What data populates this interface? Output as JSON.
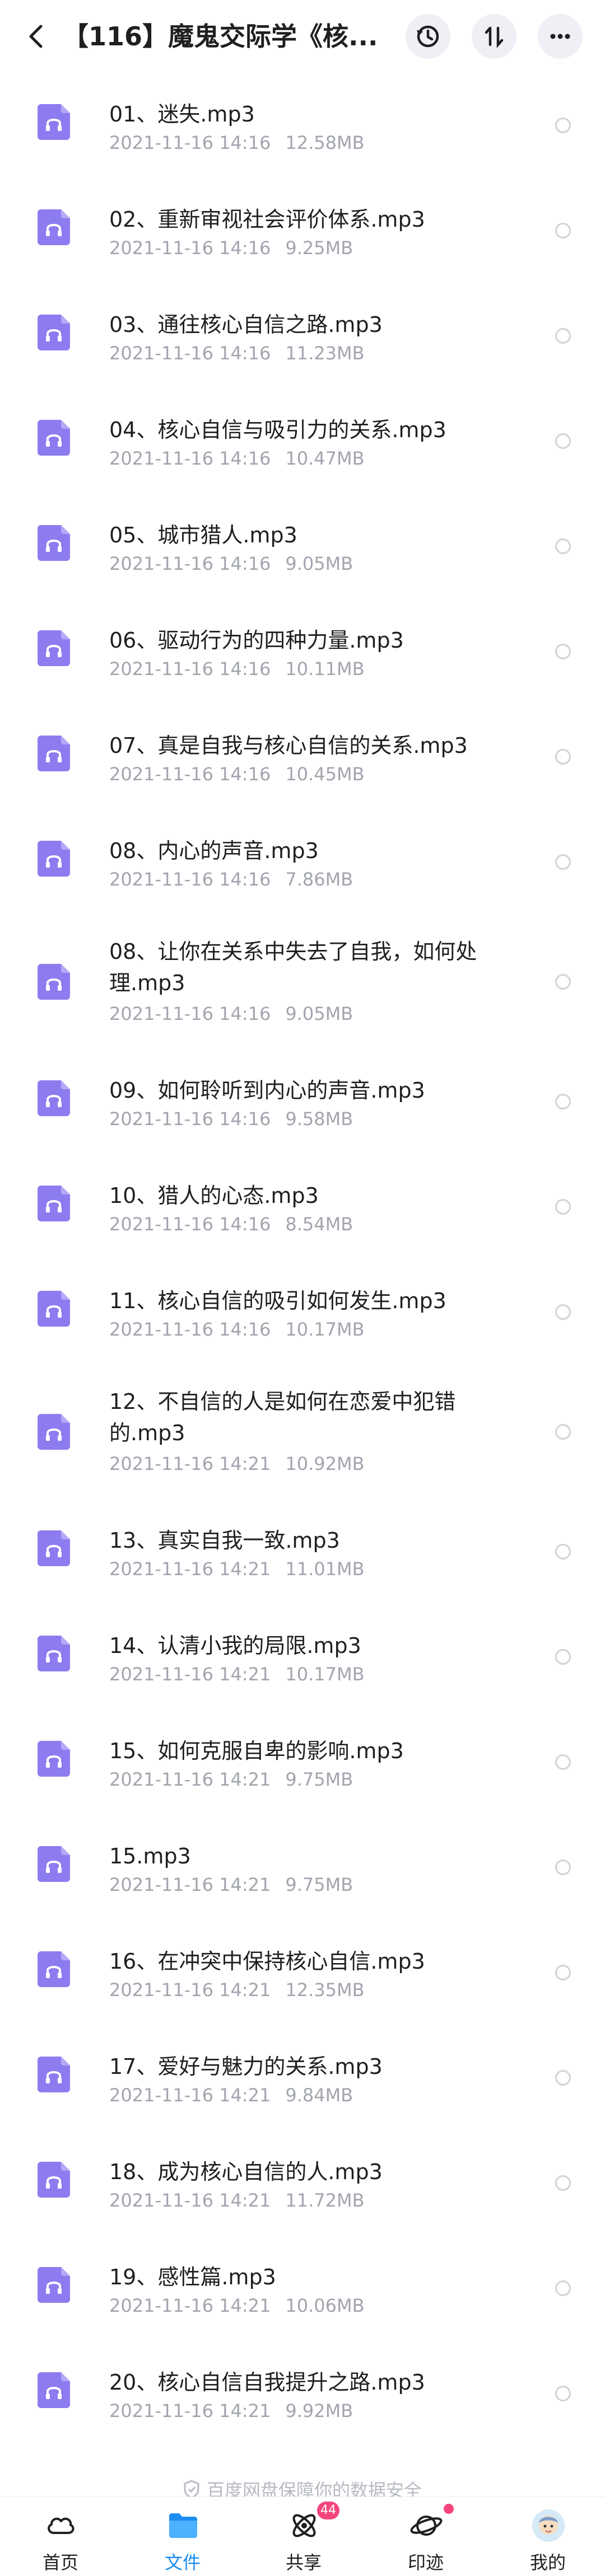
{
  "header": {
    "title": "【116】魔鬼交际学《核...",
    "icons": [
      "back-icon",
      "history-icon",
      "sort-icon",
      "more-icon"
    ]
  },
  "files": [
    {
      "name": "01、迷失.mp3",
      "date": "2021-11-16  14:16",
      "size": "12.58MB"
    },
    {
      "name": "02、重新审视社会评价体系.mp3",
      "date": "2021-11-16  14:16",
      "size": "9.25MB"
    },
    {
      "name": "03、通往核心自信之路.mp3",
      "date": "2021-11-16  14:16",
      "size": "11.23MB"
    },
    {
      "name": "04、核心自信与吸引力的关系.mp3",
      "date": "2021-11-16  14:16",
      "size": "10.47MB"
    },
    {
      "name": "05、城市猎人.mp3",
      "date": "2021-11-16  14:16",
      "size": "9.05MB"
    },
    {
      "name": "06、驱动行为的四种力量.mp3",
      "date": "2021-11-16  14:16",
      "size": "10.11MB"
    },
    {
      "name": "07、真是自我与核心自信的关系.mp3",
      "date": "2021-11-16  14:16",
      "size": "10.45MB"
    },
    {
      "name": "08、内心的声音.mp3",
      "date": "2021-11-16  14:16",
      "size": "7.86MB"
    },
    {
      "name": "08、让你在关系中失去了自我，如何处理.mp3",
      "date": "2021-11-16  14:16",
      "size": "9.05MB"
    },
    {
      "name": "09、如何聆听到内心的声音.mp3",
      "date": "2021-11-16  14:16",
      "size": "9.58MB"
    },
    {
      "name": "10、猎人的心态.mp3",
      "date": "2021-11-16  14:16",
      "size": "8.54MB"
    },
    {
      "name": "11、核心自信的吸引如何发生.mp3",
      "date": "2021-11-16  14:16",
      "size": "10.17MB"
    },
    {
      "name": "12、不自信的人是如何在恋爱中犯错的.mp3",
      "date": "2021-11-16  14:21",
      "size": "10.92MB"
    },
    {
      "name": "13、真实自我一致.mp3",
      "date": "2021-11-16  14:21",
      "size": "11.01MB"
    },
    {
      "name": "14、认清小我的局限.mp3",
      "date": "2021-11-16  14:21",
      "size": "10.17MB"
    },
    {
      "name": "15、如何克服自卑的影响.mp3",
      "date": "2021-11-16  14:21",
      "size": "9.75MB"
    },
    {
      "name": "15.mp3",
      "date": "2021-11-16  14:21",
      "size": "9.75MB"
    },
    {
      "name": "16、在冲突中保持核心自信.mp3",
      "date": "2021-11-16  14:21",
      "size": "12.35MB"
    },
    {
      "name": "17、爱好与魅力的关系.mp3",
      "date": "2021-11-16  14:21",
      "size": "9.84MB"
    },
    {
      "name": "18、成为核心自信的人.mp3",
      "date": "2021-11-16  14:21",
      "size": "11.72MB"
    },
    {
      "name": "19、感性篇.mp3",
      "date": "2021-11-16  14:21",
      "size": "10.06MB"
    },
    {
      "name": "20、核心自信自我提升之路.mp3",
      "date": "2021-11-16  14:21",
      "size": "9.92MB"
    }
  ],
  "footer_note": "百度网盘保障你的数据安全",
  "tabs": [
    {
      "label": "首页",
      "icon": "home-icon"
    },
    {
      "label": "文件",
      "icon": "folder-icon",
      "active": true
    },
    {
      "label": "共享",
      "icon": "share-icon",
      "badge": "44"
    },
    {
      "label": "印迹",
      "icon": "planet-icon",
      "dot": true
    },
    {
      "label": "我的",
      "icon": "avatar-icon"
    }
  ],
  "colors": {
    "accent": "#1b8cf0",
    "file_icon": "#8c7cf0",
    "badge": "#f5457c"
  }
}
